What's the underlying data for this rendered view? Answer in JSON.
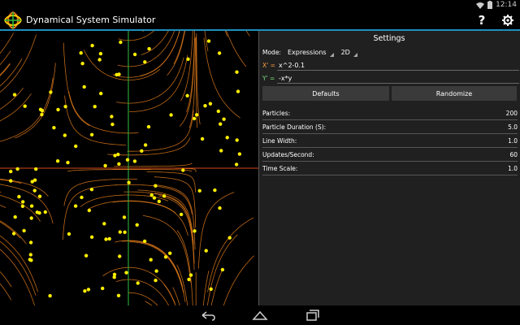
{
  "status_bar": {
    "time": "12:14"
  },
  "app": {
    "title": "Dynamical System Simulator",
    "help_label": "?"
  },
  "settings": {
    "title": "Settings",
    "mode_label": "Mode:",
    "mode_value": "Expressions",
    "dimension_value": "2D",
    "x_label": "X' =",
    "x_value": "x^2-0.1",
    "y_label": "Y' =",
    "y_value": "-x*y",
    "defaults_label": "Defaults",
    "randomize_label": "Randomize",
    "params": [
      {
        "label": "Particles:",
        "value": "200"
      },
      {
        "label": "Particle Duration (S):",
        "value": "5.0"
      },
      {
        "label": "Line Width:",
        "value": "1.0"
      },
      {
        "label": "Updates/Second:",
        "value": "60"
      },
      {
        "label": "Time Scale:",
        "value": "1.0"
      }
    ]
  },
  "colors": {
    "accent": "#1f8fbf",
    "x_axis": "#d34a1a",
    "y_axis": "#2fbf3f",
    "trail": "#e07a1a",
    "particle": "#ffee00",
    "label_x": "#ff9f3f",
    "label_y": "#7fdf7f"
  },
  "icons": {
    "app": "app-logo-icon",
    "help": "help-icon",
    "settings": "gear-icon",
    "back": "back-icon",
    "home": "home-icon",
    "recents": "recents-icon",
    "wifi": "wifi-icon",
    "battery": "battery-icon"
  }
}
